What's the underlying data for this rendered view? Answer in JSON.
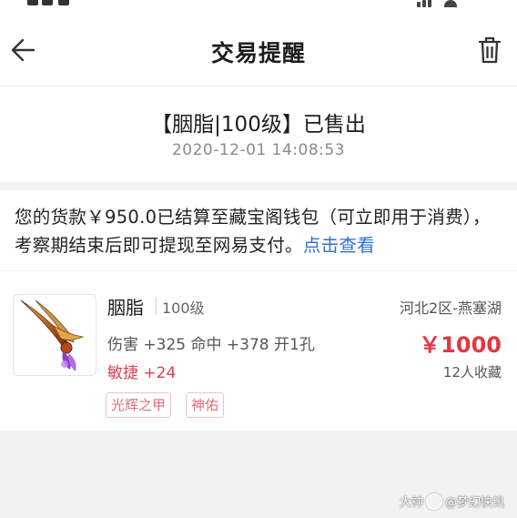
{
  "header": {
    "title": "交易提醒",
    "back_icon": "arrow-left-icon",
    "delete_icon": "trash-icon"
  },
  "notice": {
    "title": "【胭脂|100级】已售出",
    "time": "2020-12-01 14:08:53"
  },
  "message": {
    "text": "您的货款￥950.0已结算至藏宝阁钱包（可立即用于消费），考察期结束后即可提现至网易支付。",
    "link_label": "点击查看",
    "link_color": "#2d6fd1"
  },
  "item": {
    "name": "胭脂",
    "level": "100级",
    "stats": "伤害 +325 命中 +378 开1孔",
    "extra_stat": "敏捷 +24",
    "tags": [
      "光辉之甲",
      "神佑"
    ],
    "server": "河北2区-燕塞湖",
    "price": "￥1000",
    "favorites": "12人收藏",
    "price_color": "#e2373f",
    "icon": "weapon-claw-icon"
  },
  "watermark": {
    "brand": "大神",
    "account": "@梦幻快讯"
  }
}
